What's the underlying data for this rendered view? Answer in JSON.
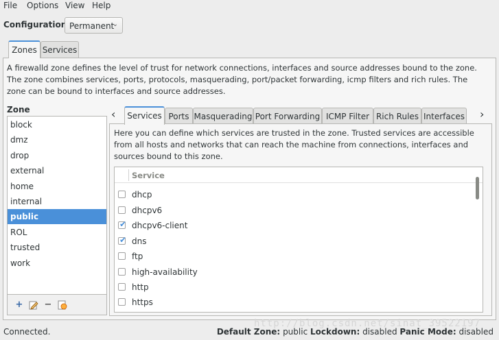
{
  "menu": [
    "File",
    "Options",
    "View",
    "Help"
  ],
  "configuration": {
    "label": "Configuration:",
    "value": "Permanent"
  },
  "main_tabs": [
    {
      "label": "Zones",
      "active": true
    },
    {
      "label": "Services",
      "active": false
    }
  ],
  "zone_description": "A firewalld zone defines the level of trust for network connections, interfaces and source addresses bound to the zone. The zone combines services, ports, protocols, masquerading, port/packet forwarding, icmp filters and rich rules. The zone can be bound to interfaces and source addresses.",
  "zones": {
    "heading": "Zone",
    "items": [
      "block",
      "dmz",
      "drop",
      "external",
      "home",
      "internal",
      "public",
      "ROL",
      "trusted",
      "work"
    ],
    "selected": "public"
  },
  "zone_toolbar": {
    "add_icon": "plus-icon",
    "edit_icon": "edit-icon",
    "remove_icon": "minus-icon",
    "load_defaults_icon": "load-defaults-icon"
  },
  "inner_tabs": [
    {
      "label": "Services",
      "active": true
    },
    {
      "label": "Ports",
      "active": false
    },
    {
      "label": "Masquerading",
      "active": false
    },
    {
      "label": "Port Forwarding",
      "active": false
    },
    {
      "label": "ICMP Filter",
      "active": false
    },
    {
      "label": "Rich Rules",
      "active": false
    },
    {
      "label": "Interfaces",
      "active": false
    }
  ],
  "services_description": "Here you can define which services are trusted in the zone. Trusted services are accessible from all hosts and networks that can reach the machine from connections, interfaces and sources bound to this zone.",
  "service_list": {
    "header": "Service",
    "rows": [
      {
        "name": "dhcp",
        "checked": false
      },
      {
        "name": "dhcpv6",
        "checked": false
      },
      {
        "name": "dhcpv6-client",
        "checked": true
      },
      {
        "name": "dns",
        "checked": true
      },
      {
        "name": "ftp",
        "checked": false
      },
      {
        "name": "high-availability",
        "checked": false
      },
      {
        "name": "http",
        "checked": false
      },
      {
        "name": "https",
        "checked": false
      }
    ]
  },
  "status": {
    "connection": "Connected.",
    "default_zone_label": "Default Zone:",
    "default_zone_value": "public",
    "lockdown_label": "Lockdown:",
    "lockdown_value": "disabled",
    "panic_label": "Panic Mode:",
    "panic_value": "disabled"
  },
  "watermark": "http://blog.csdn.net/sinat_39522197",
  "colors": {
    "accent": "#4a90d9",
    "background": "#ededed",
    "panel": "#f6f6f6"
  }
}
